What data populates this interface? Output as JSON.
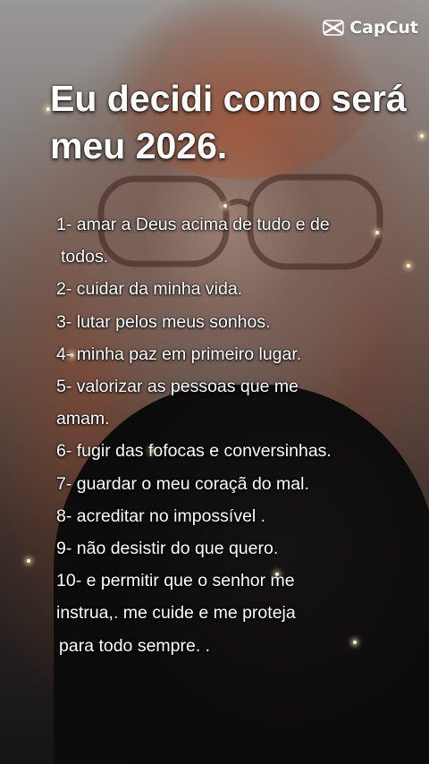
{
  "watermark": {
    "label": "CapCut",
    "icon": "capcut-logo-icon"
  },
  "title": {
    "line1": "Eu decidi como será",
    "line2": "meu 2026."
  },
  "list_lines": [
    "1- amar a Deus acima de tudo e de",
    "todos.",
    "2- cuidar da minha vida.",
    "3- lutar pelos meus sonhos.",
    "4- minha paz em primeiro lugar.",
    "5- valorizar as pessoas que me",
    "amam.",
    "6- fugir das fofocas e conversinhas.",
    "7- guardar o meu coraçã  do mal.",
    "8- acreditar no impossível .",
    "9- não desistir do que quero.",
    "10- e permitir que o senhor me",
    "instrua,. me cuide e me proteja",
    "para todo sempre. ."
  ],
  "colors": {
    "text": "#ffffff",
    "hair_accent": "#b9552d",
    "sparkle": "#fff4c8"
  }
}
